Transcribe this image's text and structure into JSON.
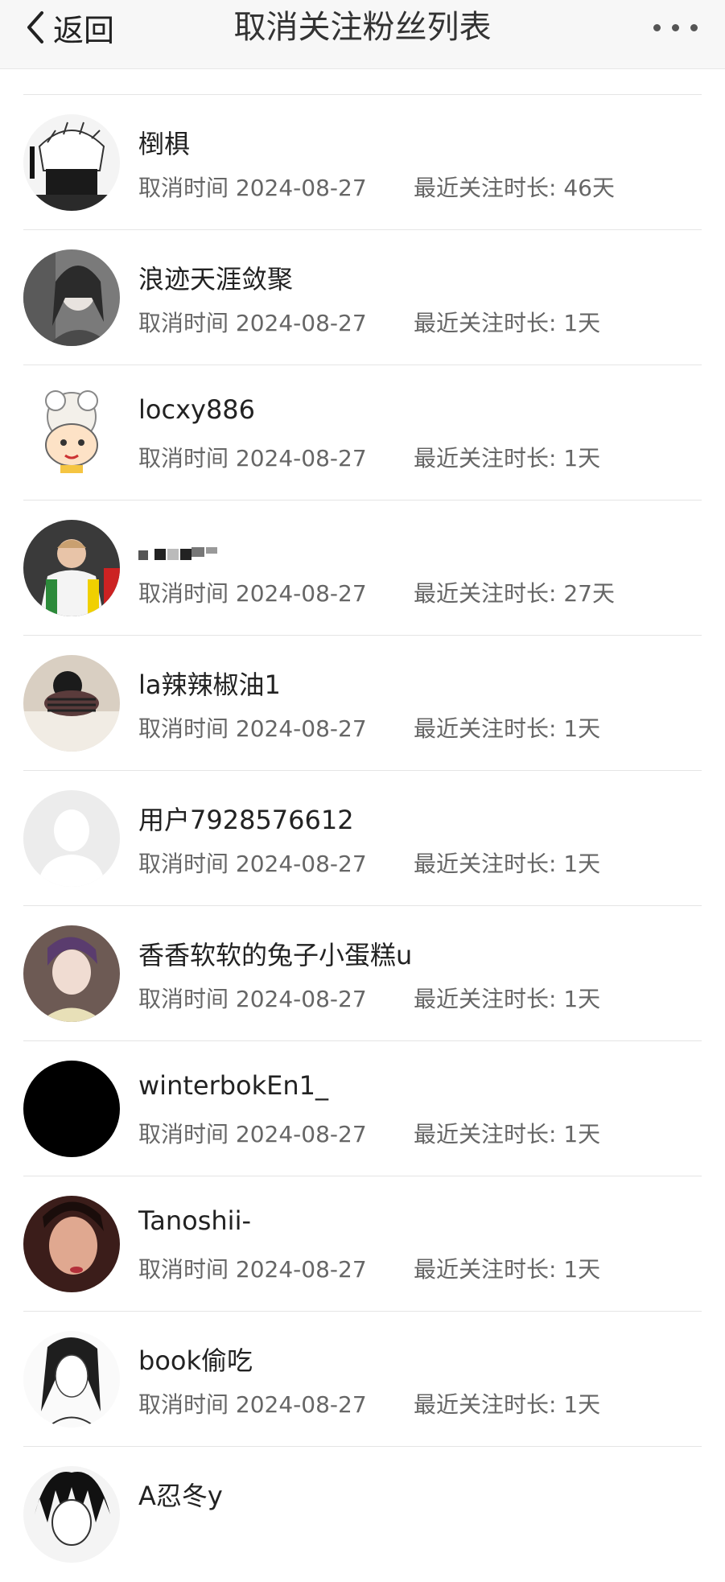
{
  "nav": {
    "back_label": "返回",
    "title": "取消关注粉丝列表"
  },
  "labels": {
    "cancel_prefix": "取消时间",
    "duration_prefix": "最近关注时长:"
  },
  "rows": [
    {
      "name": "",
      "date": "",
      "duration": "",
      "avatar": "partial"
    },
    {
      "name": "椡椇",
      "date": "2024-08-27",
      "duration": "46天",
      "avatar": "manga"
    },
    {
      "name": "浪迹天涯敛聚",
      "date": "2024-08-27",
      "duration": "1天",
      "avatar": "photo-dark"
    },
    {
      "name": "locxy886",
      "date": "2024-08-27",
      "duration": "1天",
      "avatar": "cartoon"
    },
    {
      "name": "",
      "date": "2024-08-27",
      "duration": "27天",
      "avatar": "photo-sport"
    },
    {
      "name": "la辣辣椒油1",
      "date": "2024-08-27",
      "duration": "1天",
      "avatar": "photo-sleep"
    },
    {
      "name": "用户7928576612",
      "date": "2024-08-27",
      "duration": "1天",
      "avatar": "default"
    },
    {
      "name": "香香软软的兔子小蛋糕u",
      "date": "2024-08-27",
      "duration": "1天",
      "avatar": "photo-purple"
    },
    {
      "name": "winterbokEn1_",
      "date": "2024-08-27",
      "duration": "1天",
      "avatar": "black"
    },
    {
      "name": "Tanoshii-",
      "date": "2024-08-27",
      "duration": "1天",
      "avatar": "photo-red"
    },
    {
      "name": "book偷吃",
      "date": "2024-08-27",
      "duration": "1天",
      "avatar": "sketch"
    },
    {
      "name": "A忍冬y",
      "date": "",
      "duration": "",
      "avatar": "manga-dark"
    }
  ]
}
